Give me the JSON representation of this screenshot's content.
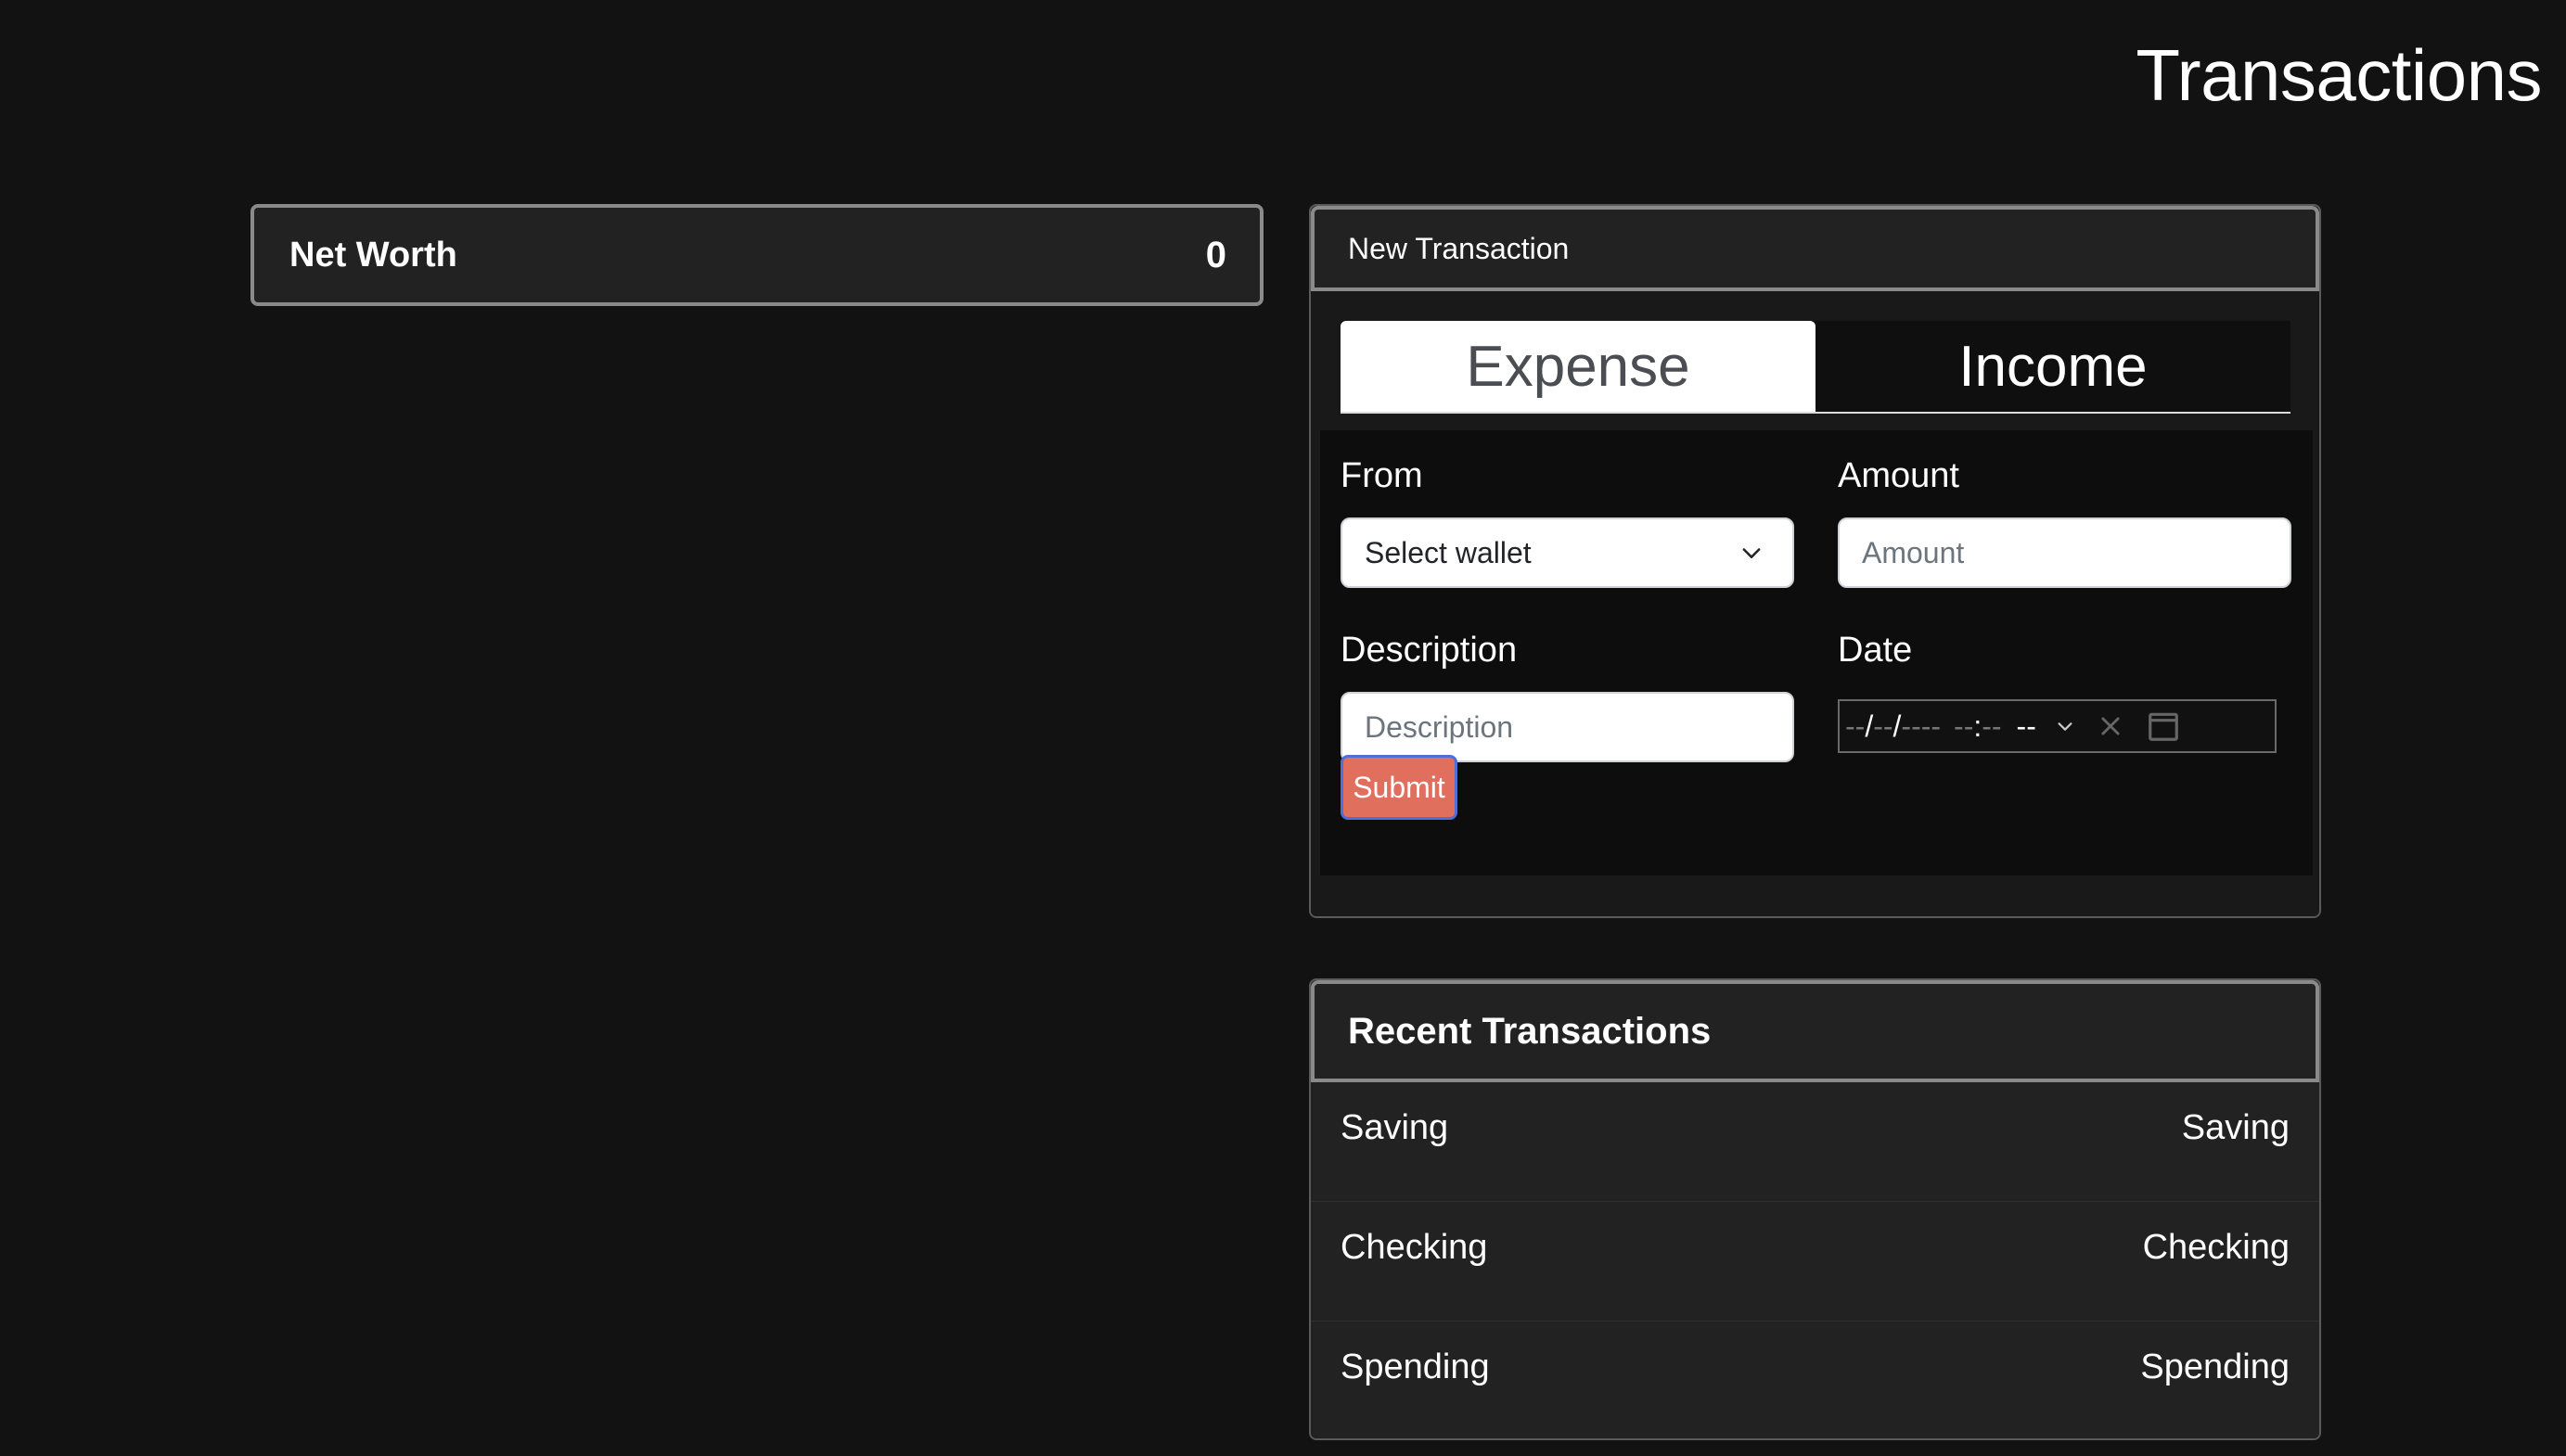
{
  "page": {
    "title": "Transactions"
  },
  "net_worth": {
    "label": "Net Worth",
    "value": "0"
  },
  "new_transaction": {
    "header": "New Transaction",
    "tabs": [
      {
        "label": "Expense",
        "active": true
      },
      {
        "label": "Income",
        "active": false
      }
    ],
    "from": {
      "label": "From",
      "selected": "Select wallet"
    },
    "amount": {
      "label": "Amount",
      "placeholder": "Amount",
      "value": ""
    },
    "description": {
      "label": "Description",
      "placeholder": "Description",
      "value": ""
    },
    "date": {
      "label": "Date",
      "mm": "--",
      "dd": "--",
      "yyyy": "----",
      "hh": "--",
      "min": "--",
      "ampm": "--"
    },
    "submit_label": "Submit"
  },
  "recent_transactions": {
    "header": "Recent Transactions",
    "rows": [
      {
        "left": "Saving",
        "right": "Saving"
      },
      {
        "left": "Checking",
        "right": "Checking"
      },
      {
        "left": "Spending",
        "right": "Spending"
      }
    ]
  },
  "colors": {
    "background": "#121212",
    "card": "#222222",
    "submit": "#e06f5e",
    "submit_border": "#4f6fd6"
  },
  "icons": {
    "select_chevron": "chevron-down-icon",
    "date_chevron": "chevron-down-icon",
    "date_clear": "close-icon",
    "calendar": "calendar-icon"
  }
}
